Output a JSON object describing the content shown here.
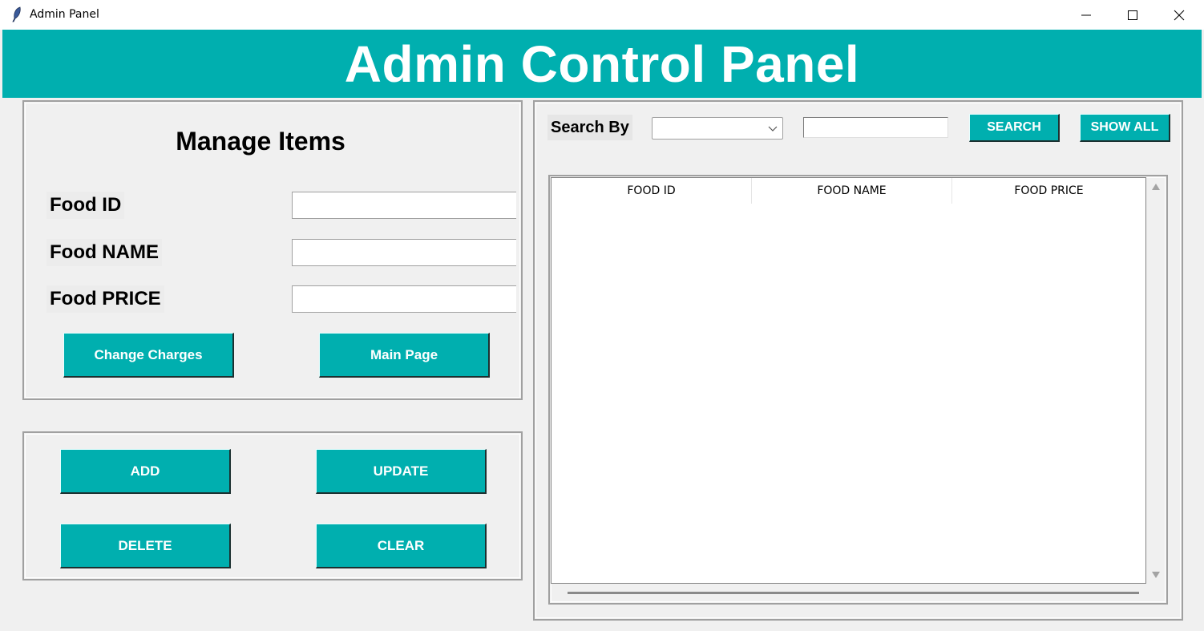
{
  "window": {
    "title": "Admin Panel",
    "controls": {
      "minimize": "minimize-icon",
      "maximize": "maximize-icon",
      "close": "close-icon"
    }
  },
  "header": {
    "title": "Admin Control Panel"
  },
  "colors": {
    "accent": "#00afaf",
    "button_text": "#ffffff",
    "background": "#f0f0f0"
  },
  "manage": {
    "title": "Manage Items",
    "fields": [
      {
        "label": "Food ID",
        "value": ""
      },
      {
        "label": "Food NAME",
        "value": ""
      },
      {
        "label": "Food PRICE",
        "value": ""
      }
    ],
    "change_charges_label": "Change Charges",
    "main_page_label": "Main Page"
  },
  "actions": {
    "add_label": "ADD",
    "update_label": "UPDATE",
    "delete_label": "DELETE",
    "clear_label": "CLEAR"
  },
  "search": {
    "label": "Search By",
    "by_selected": "",
    "query": "",
    "search_label": "SEARCH",
    "show_all_label": "SHOW ALL"
  },
  "table": {
    "columns": [
      "FOOD ID",
      "FOOD NAME",
      "FOOD PRICE"
    ],
    "rows": []
  }
}
